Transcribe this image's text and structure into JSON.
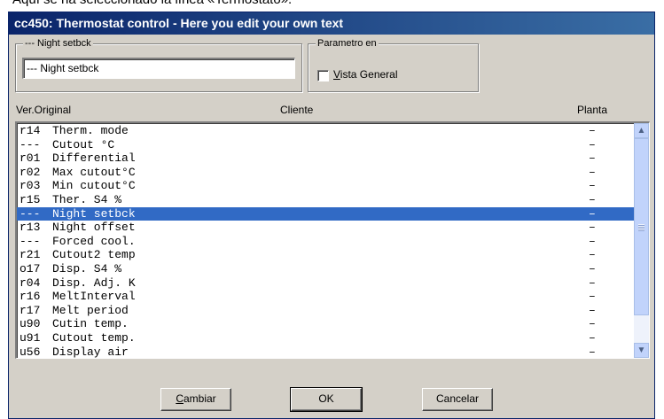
{
  "caption": "Aquí se ha seleccionado la línea «Termostato».",
  "window": {
    "title": "cc450: Thermostat control - Here you edit your own text"
  },
  "text_group": {
    "label": "--- Night setbck",
    "input_value": "--- Night setbck"
  },
  "param_group": {
    "label": "Parametro en",
    "checkbox_label_accel": "V",
    "checkbox_label_rest": "ista General",
    "checked": false
  },
  "columns": {
    "original": "Ver.Original",
    "cliente": "Cliente",
    "planta": "Planta"
  },
  "rows": [
    {
      "code": "r14",
      "text": "Therm. mode",
      "planta": "–",
      "selected": false
    },
    {
      "code": "---",
      "text": "Cutout °C",
      "planta": "–",
      "selected": false
    },
    {
      "code": "r01",
      "text": "Differential",
      "planta": "–",
      "selected": false
    },
    {
      "code": "r02",
      "text": "Max cutout°C",
      "planta": "–",
      "selected": false
    },
    {
      "code": "r03",
      "text": "Min cutout°C",
      "planta": "–",
      "selected": false
    },
    {
      "code": "r15",
      "text": "Ther. S4 %",
      "planta": "–",
      "selected": false
    },
    {
      "code": "---",
      "text": "Night setbck",
      "planta": "–",
      "selected": true
    },
    {
      "code": "r13",
      "text": "Night offset",
      "planta": "–",
      "selected": false
    },
    {
      "code": "---",
      "text": "Forced cool.",
      "planta": "–",
      "selected": false
    },
    {
      "code": "r21",
      "text": "Cutout2 temp",
      "planta": "–",
      "selected": false
    },
    {
      "code": "o17",
      "text": "Disp. S4 %",
      "planta": "–",
      "selected": false
    },
    {
      "code": "r04",
      "text": "Disp. Adj. K",
      "planta": "–",
      "selected": false
    },
    {
      "code": "r16",
      "text": "MeltInterval",
      "planta": "–",
      "selected": false
    },
    {
      "code": "r17",
      "text": "Melt period",
      "planta": "–",
      "selected": false
    },
    {
      "code": "u90",
      "text": "Cutin temp.",
      "planta": "–",
      "selected": false
    },
    {
      "code": "u91",
      "text": "Cutout temp.",
      "planta": "–",
      "selected": false
    },
    {
      "code": "u56",
      "text": "Display air",
      "planta": "–",
      "selected": false
    }
  ],
  "buttons": {
    "cambiar_accel": "C",
    "cambiar_rest": "ambiar",
    "ok": "OK",
    "cancelar": "Cancelar"
  },
  "icons": {
    "scroll_up": "scroll-up-arrow-icon",
    "scroll_down": "scroll-down-arrow-icon"
  },
  "colors": {
    "selection": "#316ac5",
    "titlebar_start": "#0a246a",
    "titlebar_end": "#3a6ea5",
    "dialog_face": "#d4d0c8"
  }
}
